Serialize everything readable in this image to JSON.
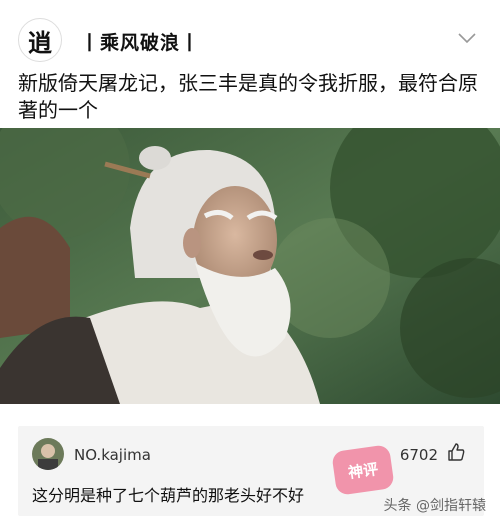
{
  "post": {
    "author": "丨乘风破浪丨",
    "avatar_char": "逍",
    "text": "新版倚天屠龙记，张三丰是真的令我折服，最符合原著的一个",
    "image_icon": "old-man-photo"
  },
  "comment": {
    "user": "NO.kajima",
    "likes": "6702",
    "text": "这分明是种了七个葫芦的那老头好不好",
    "stamp": "神评"
  },
  "watermark": "头条 @剑指轩辕"
}
